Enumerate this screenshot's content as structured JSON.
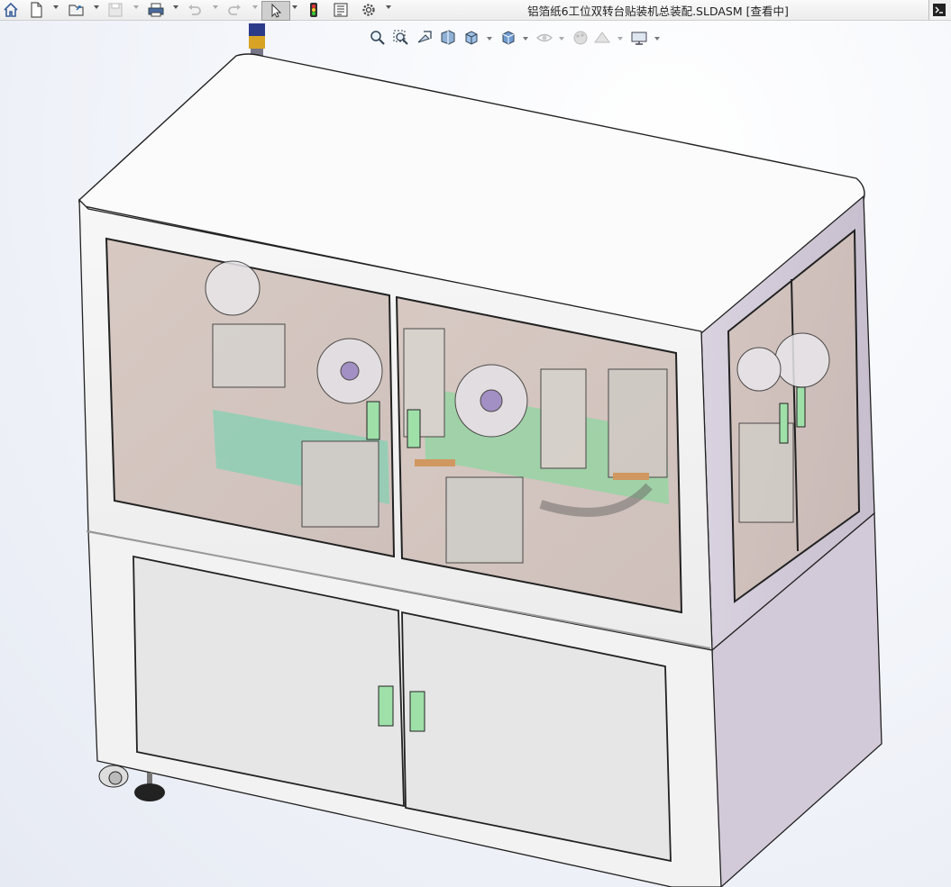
{
  "window": {
    "title": "铝箔纸6工位双转台贴装机总装配.SLDASM [查看中]"
  },
  "toolbar": {
    "buttons": [
      {
        "name": "home-icon"
      },
      {
        "name": "new-document-icon"
      },
      {
        "name": "open-folder-icon"
      },
      {
        "name": "save-icon"
      },
      {
        "name": "print-icon"
      },
      {
        "name": "undo-icon"
      },
      {
        "name": "redo-icon"
      },
      {
        "name": "select-cursor-icon"
      },
      {
        "name": "traffic-light-icon"
      },
      {
        "name": "file-properties-icon"
      },
      {
        "name": "options-gear-icon"
      }
    ]
  },
  "heads_up_toolbar": {
    "buttons": [
      {
        "name": "zoom-to-fit-icon"
      },
      {
        "name": "zoom-to-area-icon"
      },
      {
        "name": "previous-view-icon"
      },
      {
        "name": "section-view-icon"
      },
      {
        "name": "view-orientation-icon"
      },
      {
        "name": "display-style-icon"
      },
      {
        "name": "hide-show-items-icon"
      },
      {
        "name": "edit-appearance-icon"
      },
      {
        "name": "apply-scene-icon"
      },
      {
        "name": "view-settings-icon"
      }
    ]
  },
  "colors": {
    "frame_white": "#f4f4f4",
    "frame_side": "#d6cedc",
    "glass_tint": "#cdbdb6",
    "handle_green": "#7fd48f",
    "floor_green": "#7fc9a8"
  }
}
